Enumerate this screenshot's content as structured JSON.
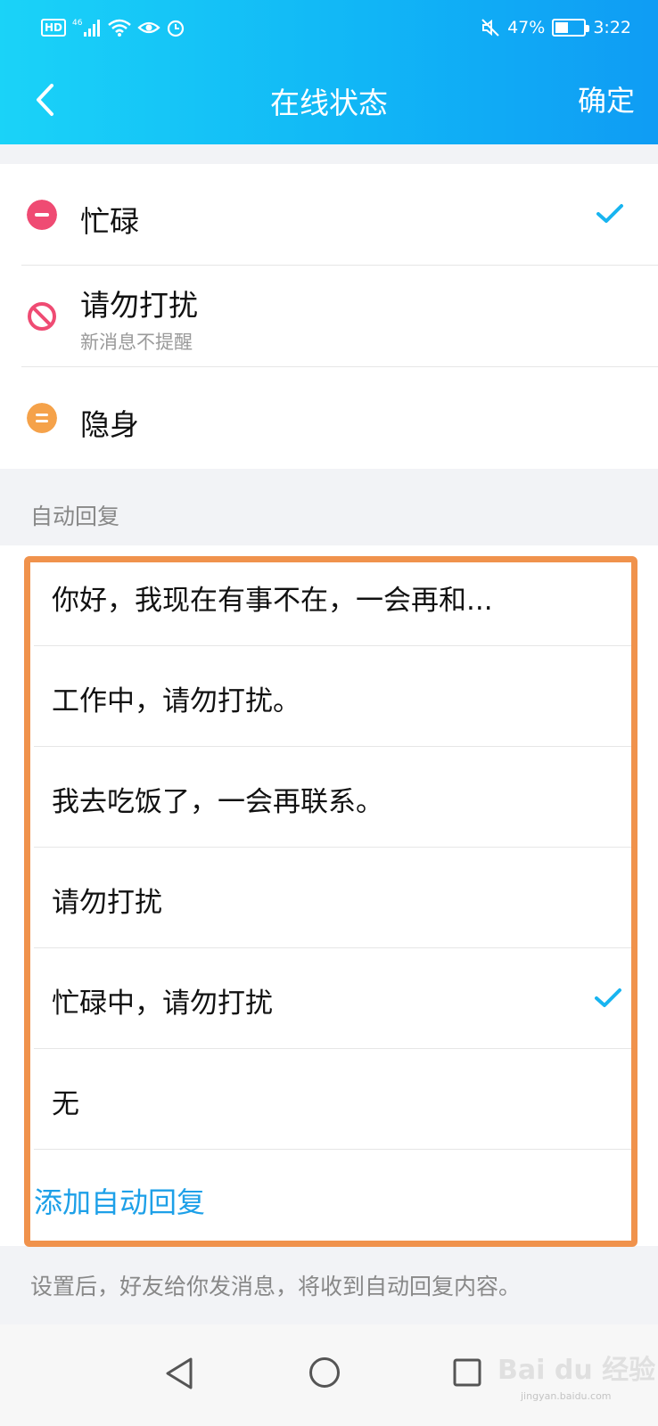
{
  "status_bar": {
    "hd": "HD",
    "network": "46",
    "battery_percent": "47%",
    "battery_level": 0.47,
    "time": "3:22",
    "icons": [
      "hd-icon",
      "signal-icon",
      "wifi-icon",
      "eye-icon",
      "alarm-icon",
      "mute-icon",
      "battery-icon"
    ]
  },
  "nav": {
    "title": "在线状态",
    "confirm": "确定"
  },
  "statuses": [
    {
      "label": "忙碌",
      "icon": "busy-icon",
      "color": "#ef4b73",
      "selected": true
    },
    {
      "label": "请勿打扰",
      "sub": "新消息不提醒",
      "icon": "do-not-disturb-icon",
      "color": "#ef4b73",
      "selected": false
    },
    {
      "label": "隐身",
      "icon": "invisible-icon",
      "color": "#f5a24a",
      "selected": false
    }
  ],
  "auto_reply": {
    "section_title": "自动回复",
    "items": [
      {
        "text": "你好，我现在有事不在，一会再和...",
        "selected": false
      },
      {
        "text": "工作中，请勿打扰。",
        "selected": false
      },
      {
        "text": "我去吃饭了，一会再联系。",
        "selected": false
      },
      {
        "text": "请勿打扰",
        "selected": false
      },
      {
        "text": "忙碌中，请勿打扰",
        "selected": true
      },
      {
        "text": "无",
        "selected": false
      }
    ],
    "add_label": "添加自动回复",
    "footer_note": "设置后，好友给你发消息，将收到自动回复内容。"
  },
  "watermark": {
    "text": "Bai du 经验",
    "sub": "jingyan.baidu.com"
  },
  "colors": {
    "header_start": "#1ad3f8",
    "header_end": "#0f9cf4",
    "check": "#18b4f0",
    "link": "#1da0e8",
    "highlight": "#f0924c"
  }
}
